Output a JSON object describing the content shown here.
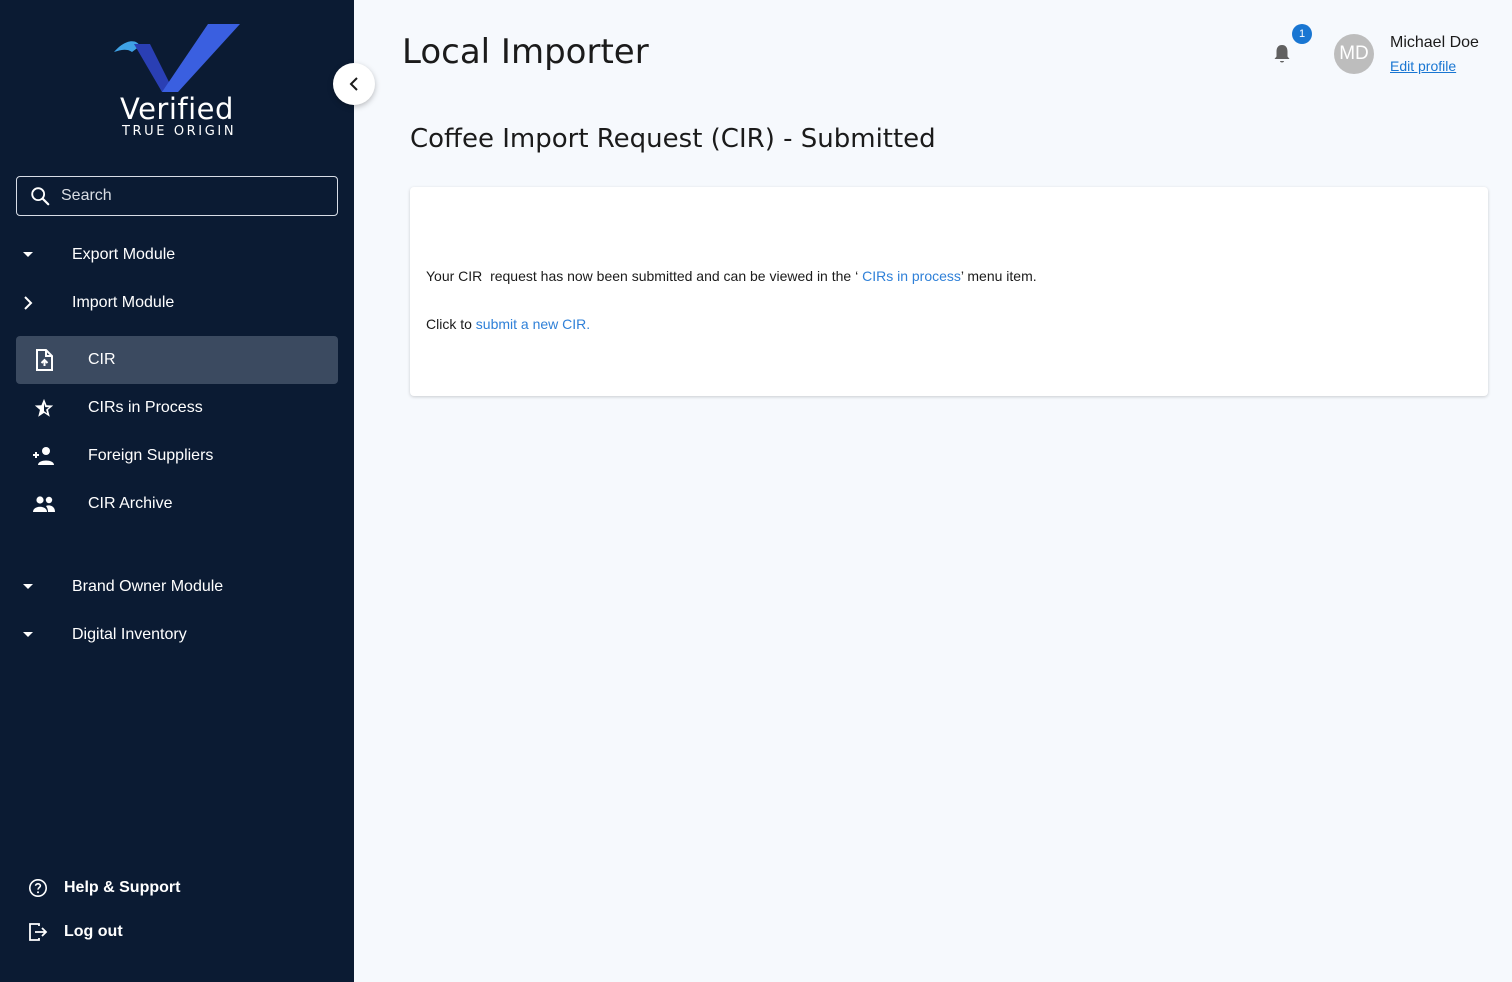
{
  "brand": {
    "name": "Verified",
    "tagline": "TRUE ORIGIN"
  },
  "sidebar": {
    "search_placeholder": "Search",
    "modules": {
      "export": "Export Module",
      "import": "Import Module",
      "brand_owner": "Brand Owner Module",
      "digital_inventory": "Digital Inventory"
    },
    "import_items": [
      {
        "label": "CIR",
        "icon": "file-upload-icon",
        "active": true
      },
      {
        "label": "CIRs in Process",
        "icon": "star-icon",
        "active": false
      },
      {
        "label": "Foreign Suppliers",
        "icon": "add-person-icon",
        "active": false
      },
      {
        "label": "CIR Archive",
        "icon": "group-icon",
        "active": false
      }
    ],
    "footer": {
      "help": "Help & Support",
      "logout": "Log out"
    }
  },
  "header": {
    "title": "Local Importer",
    "notifications_count": "1",
    "user": {
      "initials": "MD",
      "name": "Michael Doe",
      "edit_label": "Edit profile"
    }
  },
  "main": {
    "section_title": "Coffee Import Request (CIR) - Submitted",
    "message": {
      "prefix": "Your CIR  request has now been submitted and can be viewed in the ‘ ",
      "link": "CIRs in process",
      "suffix": "’ menu item."
    },
    "message2": {
      "prefix": "Click to ",
      "link": "submit a new CIR."
    }
  },
  "colors": {
    "sidebar_bg": "#0b1b33",
    "active_item_bg": "#3b4a60",
    "accent": "#1976d2",
    "link": "#2f80d8",
    "page_bg": "#f6f9fd"
  }
}
